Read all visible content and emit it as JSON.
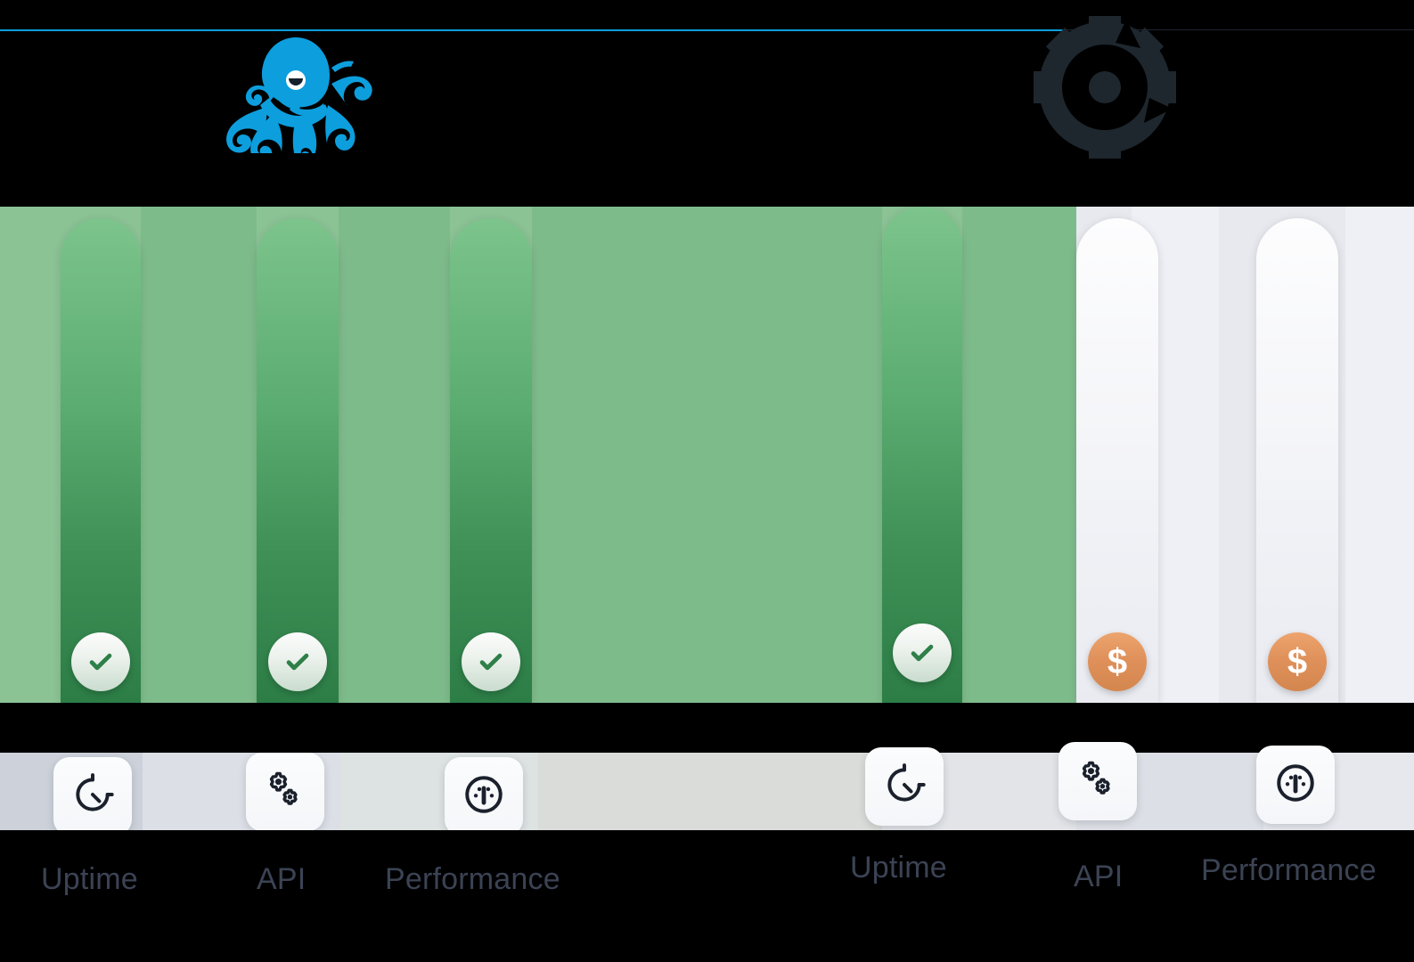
{
  "header": {
    "brand_logo": "octopus-logo",
    "brand_logo_color": "#0d9edd",
    "secondary_logo": "gear-shutter-logo",
    "secondary_logo_color": "#1e272e",
    "rule_color": "#0d9edd"
  },
  "colors": {
    "panel_left_bg": "#8bc395",
    "panel_left_band": "#7ebb8b",
    "panel_right_bg": "#eceef4",
    "bar_green_top": "#7cc48c",
    "bar_green_bottom": "#2c7d46",
    "bar_white_top": "#fdfdfe",
    "bar_white_bottom": "#e9ebf1",
    "badge_check_bg": "#eef3ee",
    "badge_check_mark": "#2f7f48",
    "badge_money_bg": "#e0915b",
    "badge_money_text": "#ffffff",
    "axis_strip_bg": "#d4d8e0",
    "axis_label_text": "#3b4354",
    "background": "#000000"
  },
  "chart_data": {
    "type": "bar",
    "title": "",
    "xlabel": "",
    "ylabel": "",
    "grid": false,
    "legend": "none",
    "panels": [
      {
        "name": "left-panel",
        "theme": "green",
        "categories": [
          "Uptime",
          "API",
          "Performance",
          "Uptime"
        ],
        "values": [
          100,
          100,
          100,
          97
        ],
        "ylim": [
          0,
          100
        ],
        "marker": "check"
      },
      {
        "name": "right-panel",
        "theme": "light",
        "categories": [
          "API",
          "Performance"
        ],
        "values": [
          100,
          100
        ],
        "ylim": [
          0,
          100
        ],
        "marker": "dollar"
      }
    ]
  },
  "bars": [
    {
      "id": "bar-1",
      "label": "Uptime",
      "panel": "left",
      "badge": "check",
      "badge_glyph": "✓",
      "value": 100
    },
    {
      "id": "bar-2",
      "label": "API",
      "panel": "left",
      "badge": "check",
      "badge_glyph": "✓",
      "value": 100
    },
    {
      "id": "bar-3",
      "label": "Performance",
      "panel": "left",
      "badge": "check",
      "badge_glyph": "✓",
      "value": 100
    },
    {
      "id": "bar-4",
      "label": "Uptime",
      "panel": "left",
      "badge": "check",
      "badge_glyph": "✓",
      "value": 97
    },
    {
      "id": "bar-5",
      "label": "API",
      "panel": "right",
      "badge": "dollar",
      "badge_glyph": "$",
      "value": 100
    },
    {
      "id": "bar-6",
      "label": "Performance",
      "panel": "right",
      "badge": "dollar",
      "badge_glyph": "$",
      "value": 100
    }
  ],
  "axis": {
    "items": [
      {
        "label": "Uptime",
        "icon": "timer-icon"
      },
      {
        "label": "API",
        "icon": "gears-icon"
      },
      {
        "label": "Performance",
        "icon": "gauge-icon"
      },
      {
        "label": "Uptime",
        "icon": "timer-icon"
      },
      {
        "label": "API",
        "icon": "gears-icon"
      },
      {
        "label": "Performance",
        "icon": "gauge-icon"
      }
    ]
  }
}
